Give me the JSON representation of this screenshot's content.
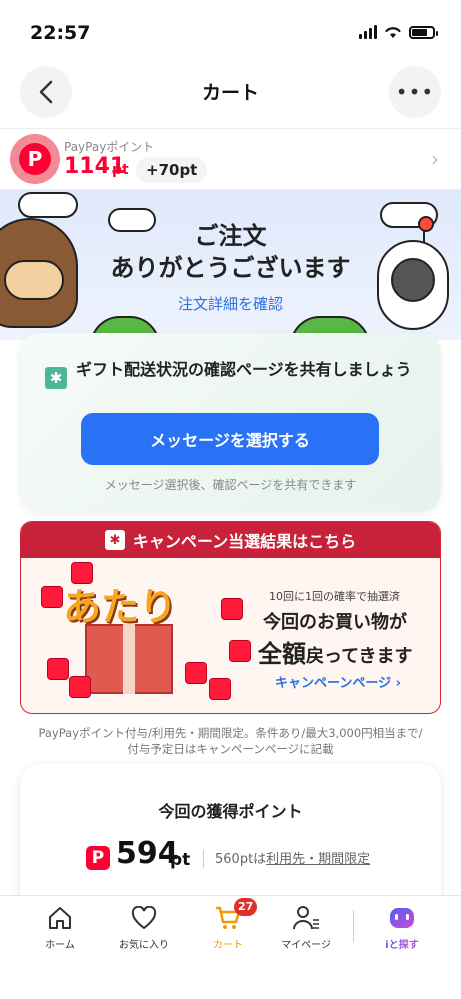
{
  "status": {
    "time": "22:57"
  },
  "nav": {
    "title": "カート",
    "back_icon": "chevron-left-icon",
    "more_icon": "more-icon",
    "more_label": "•••"
  },
  "points": {
    "label": "PayPayポイント",
    "value": "1141",
    "unit": "pt",
    "bonus": "+70pt"
  },
  "hero": {
    "title_line1": "ご注文",
    "title_line2": "ありがとうございます",
    "link": "注文詳細を確認"
  },
  "share": {
    "title": "ギフト配送状況の確認ページを共有しましょう",
    "button": "メッセージを選択する",
    "note": "メッセージ選択後、確認ページを共有できます"
  },
  "campaign": {
    "header": "キャンペーン当選結果はこちら",
    "atari": "あたり",
    "sub": "10回に1回の確率で抽選済",
    "line1": "今回のお買い物が",
    "line2_bold": "全額",
    "line2_rest": "戻ってきます",
    "link": "キャンペーンページ ›",
    "colors": {
      "header": "#c8213a",
      "accent": "#2a6fe0"
    }
  },
  "disclaimer": {
    "line1": "PayPayポイント付与/利用先・期間限定。条件あり/最大3,000円相当まで/",
    "line2": "付与予定日はキャンペーンページに記載"
  },
  "earn": {
    "title": "今回の獲得ポイント",
    "value": "594",
    "unit": "pt",
    "note_prefix": "560ptは",
    "note_link": "利用先・期間限定"
  },
  "tabbar": {
    "items": [
      {
        "label": "ホーム",
        "icon": "home-icon"
      },
      {
        "label": "お気に入り",
        "icon": "heart-icon"
      },
      {
        "label": "カート",
        "icon": "cart-icon",
        "badge": "27"
      },
      {
        "label": "マイページ",
        "icon": "user-icon"
      },
      {
        "label": "iと探す",
        "icon": "ai-assistant-icon"
      }
    ]
  },
  "colors": {
    "paypay_red": "#ff0033",
    "primary_blue": "#2a72f5",
    "active_tab": "#f39800"
  }
}
